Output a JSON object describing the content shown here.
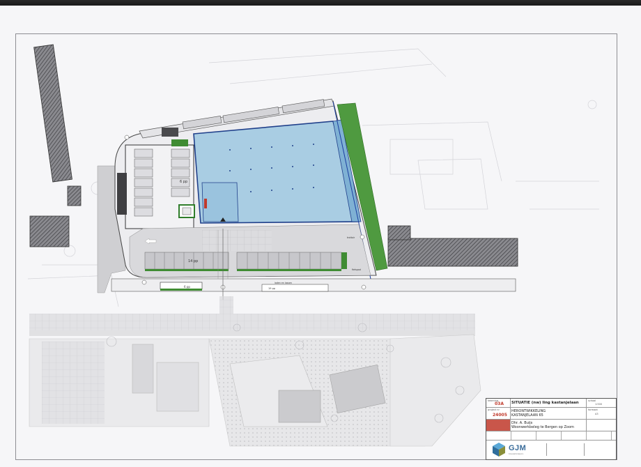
{
  "title_block": {
    "sheet_label": "tekening",
    "sheet_number": "03A",
    "title": "SITUATIE (nw) ling kastanjelaan",
    "project_number_label": "project nr",
    "project_number": "24005",
    "project_name_line1": "HERONTWIKKELING",
    "project_name_line2": "KASTANJELAAN 65",
    "client_line1": "Dhr. A. Buijs",
    "client_line2": "Woonwerkbeleg te Bergen op Zoom",
    "scale_label": "schaal",
    "scale_value": "1:500",
    "format_label": "formaat",
    "format_value": "A3",
    "company_name": "GJM",
    "company_sub": "bouwadviseurs"
  },
  "plan_labels": {
    "parking_count_a": "19 pp",
    "parking_count_b": "6 pp",
    "parking_count_c": "14 pp",
    "parking_count_d": "6 pp",
    "bike_area": "fietsenstalling",
    "road_marker": "B",
    "loading_note": "laden en lossen",
    "footpath_note": "trottoir",
    "cycle_note": "fietspad"
  },
  "colors": {
    "building_fill": "#a9cde3",
    "building_stroke": "#1f3f8a",
    "green_strip": "#4f9a40",
    "hatched_block": "#7d7d82",
    "paving": "#d6d6d8",
    "road": "#c9c9cc",
    "line_blue": "#1c3fa0"
  }
}
